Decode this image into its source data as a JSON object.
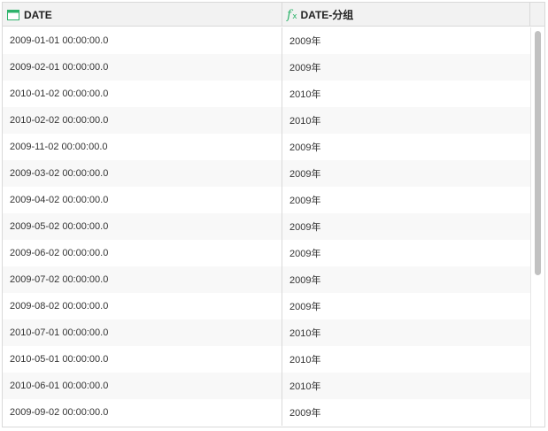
{
  "table": {
    "columns": [
      {
        "label": "DATE",
        "icon": "calendar-icon"
      },
      {
        "label": "DATE-分组",
        "icon": "formula-fx-icon"
      }
    ],
    "rows": [
      [
        "2009-01-01 00:00:00.0",
        "2009年"
      ],
      [
        "2009-02-01 00:00:00.0",
        "2009年"
      ],
      [
        "2010-01-02 00:00:00.0",
        "2010年"
      ],
      [
        "2010-02-02 00:00:00.0",
        "2010年"
      ],
      [
        "2009-11-02 00:00:00.0",
        "2009年"
      ],
      [
        "2009-03-02 00:00:00.0",
        "2009年"
      ],
      [
        "2009-04-02 00:00:00.0",
        "2009年"
      ],
      [
        "2009-05-02 00:00:00.0",
        "2009年"
      ],
      [
        "2009-06-02 00:00:00.0",
        "2009年"
      ],
      [
        "2009-07-02 00:00:00.0",
        "2009年"
      ],
      [
        "2009-08-02 00:00:00.0",
        "2009年"
      ],
      [
        "2010-07-01 00:00:00.0",
        "2010年"
      ],
      [
        "2010-05-01 00:00:00.0",
        "2010年"
      ],
      [
        "2010-06-01 00:00:00.0",
        "2010年"
      ],
      [
        "2009-09-02 00:00:00.0",
        "2009年"
      ]
    ]
  },
  "colors": {
    "calendar_icon": "#2db36b",
    "fx_icon": "#2db36b"
  }
}
